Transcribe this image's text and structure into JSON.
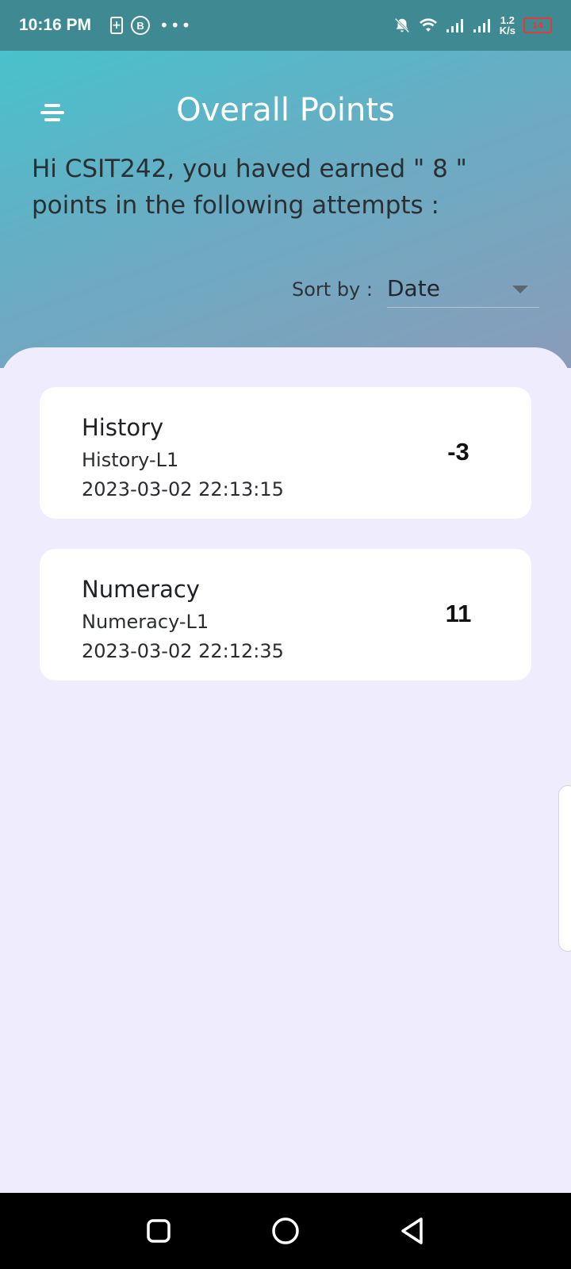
{
  "status_bar": {
    "time": "10:16 PM",
    "speed_value": "1.2",
    "speed_unit": "K/s",
    "battery_level": "14"
  },
  "header": {
    "title": "Overall Points",
    "greeting": "Hi CSIT242, you haved earned \" 8 \" points in the following attempts :",
    "sort_label": "Sort by :",
    "sort_value": "Date"
  },
  "attempts": [
    {
      "subject": "History",
      "level": "History-L1",
      "datetime": "2023-03-02 22:13:15",
      "points": "-3"
    },
    {
      "subject": "Numeracy",
      "level": "Numeracy-L1",
      "datetime": "2023-03-02 22:12:35",
      "points": "11"
    }
  ],
  "colors": {
    "status_bar": "#3f8a92",
    "header_gradient_start": "#47c2cc",
    "header_gradient_end": "#8a9cba",
    "sheet_background": "#efecfd",
    "battery_low": "#e53935"
  }
}
